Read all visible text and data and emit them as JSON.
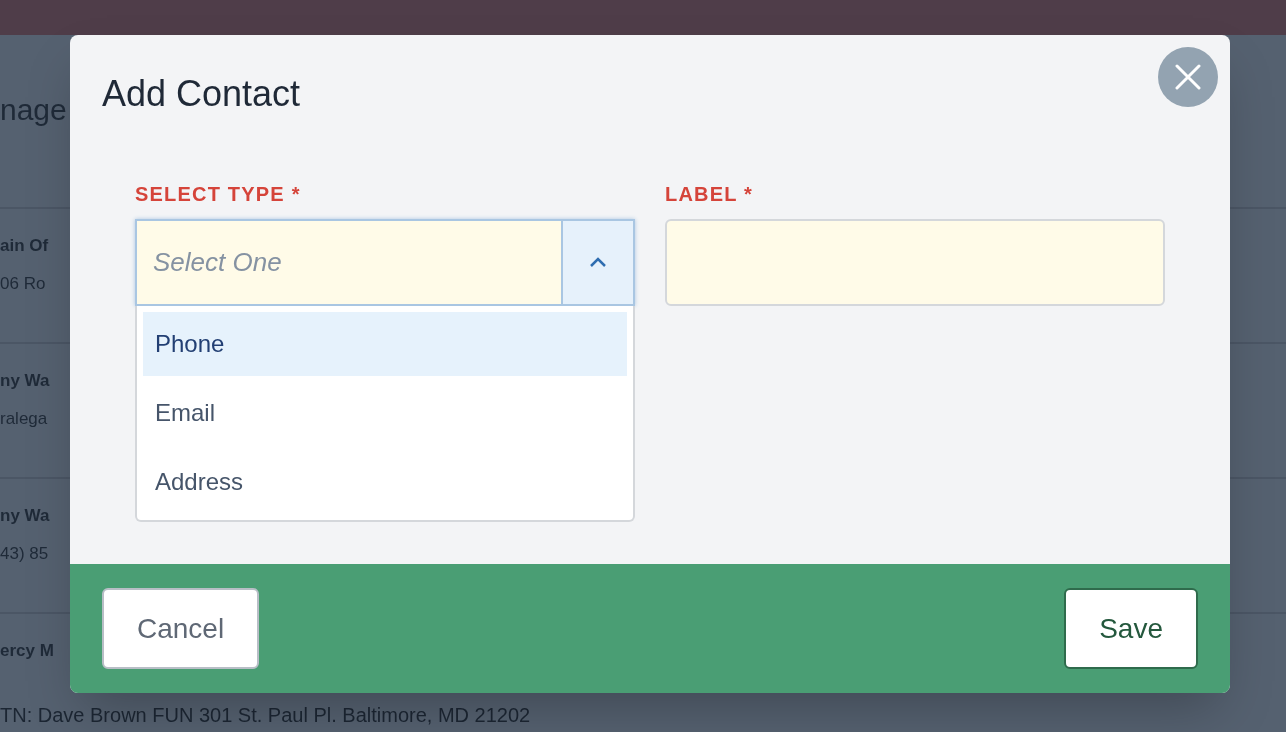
{
  "background": {
    "heading": "nage",
    "rows": [
      {
        "title": "ain Of",
        "detail": "06 Ro"
      },
      {
        "title": "ny Wa",
        "detail": "ralega"
      },
      {
        "title": "ny Wa",
        "detail": "43) 85"
      },
      {
        "title": "ercy M",
        "detail": "TN: Dave Brown FUN 301 St. Paul Pl. Baltimore, MD 21202"
      }
    ]
  },
  "dialog": {
    "title": "Add Contact",
    "fields": [
      {
        "kind": "select",
        "label": "SELECT TYPE *",
        "placeholder": "Select One",
        "expanded": true,
        "options": [
          {
            "label": "Phone",
            "selected": true
          },
          {
            "label": "Email",
            "selected": false
          },
          {
            "label": "Address",
            "selected": false
          }
        ]
      },
      {
        "kind": "text",
        "label": "LABEL *"
      }
    ],
    "buttons": [
      {
        "label": "Cancel",
        "kind": "secondary"
      },
      {
        "label": "Save",
        "kind": "primary"
      }
    ]
  }
}
